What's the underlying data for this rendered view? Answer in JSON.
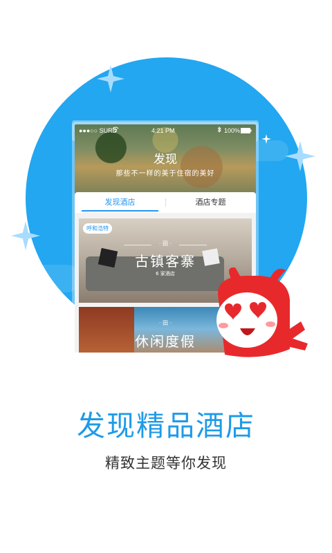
{
  "colors": {
    "accent": "#22a7f0",
    "title_blue": "#1e9be8",
    "tab_active": "#2196f3",
    "mascot_red": "#e8292c"
  },
  "phone": {
    "status": {
      "carrier": "●●●○○ SURD",
      "time": "4:21 PM",
      "battery": "100%"
    },
    "hero": {
      "title": "发现",
      "subtitle": "那些不一样的美于住宿的美好"
    },
    "tabs": [
      {
        "label": "发现酒店",
        "active": true
      },
      {
        "label": "酒店专题",
        "active": false
      }
    ],
    "cards": [
      {
        "tag": "呼和浩特",
        "mark": "· 田 ·",
        "title": "古镇客寨",
        "subtitle": "6 家酒店"
      },
      {
        "mark": "· 田 ·",
        "title": "休闲度假"
      }
    ]
  },
  "icons": [
    "sparkle-icon",
    "wifi-icon",
    "bluetooth-icon",
    "battery-icon",
    "mascot-icon"
  ],
  "headline": "发现精品酒店",
  "tagline": "精致主题等你发现"
}
